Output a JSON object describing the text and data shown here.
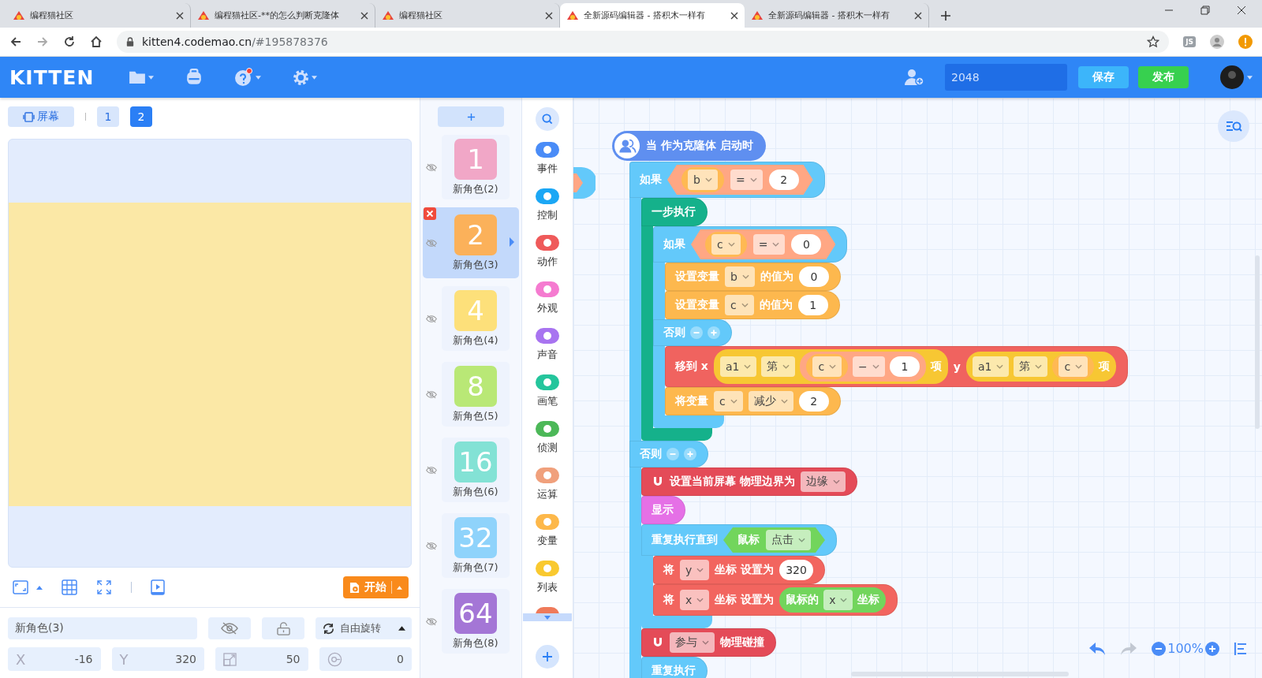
{
  "browser": {
    "tabs": [
      {
        "title": "编程猫社区",
        "selected": false
      },
      {
        "title": "编程猫社区-**的怎么判断克隆体",
        "selected": false
      },
      {
        "title": "编程猫社区",
        "selected": false
      },
      {
        "title": "全新源码编辑器 - 搭积木一样有",
        "selected": true
      },
      {
        "title": "全新源码编辑器 - 搭积木一样有",
        "selected": false
      }
    ],
    "url_host": "kitten4.codemao.cn",
    "url_path": "/#195878376",
    "extension": "JS"
  },
  "app_bar": {
    "logo": "KITTEN",
    "project_name": "2048",
    "save": "保存",
    "publish": "发布"
  },
  "stage_panel": {
    "screen_button": "屏幕",
    "screens": [
      {
        "label": "1",
        "selected": false
      },
      {
        "label": "2",
        "selected": true
      }
    ],
    "start_button": "开始"
  },
  "sprite_props": {
    "name": "新角色(3)",
    "rotation": "自由旋转",
    "fields": [
      {
        "kind": "x",
        "label": "X",
        "value": "-16"
      },
      {
        "kind": "y",
        "label": "Y",
        "value": "320"
      },
      {
        "kind": "size",
        "value": "50"
      },
      {
        "kind": "direction",
        "value": "0"
      }
    ]
  },
  "sprites": [
    {
      "number": "1",
      "name": "新角色(2)",
      "color": "#f1a7c7",
      "selected": false
    },
    {
      "number": "2",
      "name": "新角色(3)",
      "color": "#fbb15a",
      "selected": true
    },
    {
      "number": "4",
      "name": "新角色(4)",
      "color": "#fde07a",
      "selected": false
    },
    {
      "number": "8",
      "name": "新角色(5)",
      "color": "#b9e876",
      "selected": false
    },
    {
      "number": "16",
      "name": "新角色(6)",
      "color": "#83e2d5",
      "selected": false
    },
    {
      "number": "32",
      "name": "新角色(7)",
      "color": "#8fd3fb",
      "selected": false
    },
    {
      "number": "64",
      "name": "新角色(8)",
      "color": "#a476d6",
      "selected": false
    }
  ],
  "categories": [
    {
      "label": "事件",
      "color": "#4a8cf7"
    },
    {
      "label": "控制",
      "color": "#1ba7f5"
    },
    {
      "label": "动作",
      "color": "#ef5a5a"
    },
    {
      "label": "外观",
      "color": "#f57bd0"
    },
    {
      "label": "声音",
      "color": "#a874f0"
    },
    {
      "label": "画笔",
      "color": "#24c59c"
    },
    {
      "label": "侦测",
      "color": "#4cb858"
    },
    {
      "label": "运算",
      "color": "#f0a07c"
    },
    {
      "label": "变量",
      "color": "#fdb84a"
    },
    {
      "label": "列表",
      "color": "#f9c92f"
    }
  ],
  "script": {
    "hat": {
      "label": "当 作为克隆体 启动时",
      "color": "#5f8ff0"
    },
    "blocks": [
      {
        "kind": "if_else",
        "color": "#63c9fa",
        "parts": [
          {
            "kind": "text",
            "text": "如果"
          },
          {
            "kind": "bool",
            "color": "#ffa784",
            "parts": [
              {
                "kind": "reporter",
                "color": "#ffb953",
                "parts": [
                  {
                    "kind": "dropdown",
                    "text": "b"
                  }
                ]
              },
              {
                "kind": "dropdown",
                "text": "="
              },
              {
                "kind": "number",
                "text": "2"
              }
            ]
          }
        ],
        "children": [
          {
            "kind": "c",
            "color": "#15b18b",
            "parts": [
              {
                "kind": "text",
                "text": "一步执行"
              }
            ],
            "children": [
              {
                "kind": "if_else",
                "color": "#63c9fa",
                "parts": [
                  {
                    "kind": "text",
                    "text": "如果"
                  },
                  {
                    "kind": "bool",
                    "color": "#ffa784",
                    "parts": [
                      {
                        "kind": "reporter",
                        "color": "#ffb953",
                        "parts": [
                          {
                            "kind": "dropdown",
                            "text": "c"
                          }
                        ]
                      },
                      {
                        "kind": "dropdown",
                        "text": "="
                      },
                      {
                        "kind": "number",
                        "text": "0"
                      }
                    ]
                  }
                ],
                "children": [
                  {
                    "kind": "stmt",
                    "color": "#fdb84e",
                    "parts": [
                      {
                        "kind": "text",
                        "text": "设置变量"
                      },
                      {
                        "kind": "dropdown",
                        "text": "b"
                      },
                      {
                        "kind": "text",
                        "text": "的值为"
                      },
                      {
                        "kind": "number",
                        "text": "0"
                      }
                    ]
                  },
                  {
                    "kind": "stmt",
                    "color": "#fdb84e",
                    "parts": [
                      {
                        "kind": "text",
                        "text": "设置变量"
                      },
                      {
                        "kind": "dropdown",
                        "text": "c"
                      },
                      {
                        "kind": "text",
                        "text": "的值为"
                      },
                      {
                        "kind": "number",
                        "text": "1"
                      }
                    ]
                  }
                ],
                "else_label": "否则",
                "else_children": [
                  {
                    "kind": "stmt",
                    "color": "#f0635f",
                    "parts": [
                      {
                        "kind": "text",
                        "text": "移到 x"
                      },
                      {
                        "kind": "reporter",
                        "color": "#f7c733",
                        "parts": [
                          {
                            "kind": "dropdown",
                            "text": "a1"
                          },
                          {
                            "kind": "dropdown",
                            "text": "第"
                          },
                          {
                            "kind": "reporter",
                            "color": "#ffa784",
                            "parts": [
                              {
                                "kind": "reporter",
                                "color": "#ffb953",
                                "parts": [
                                  {
                                    "kind": "dropdown",
                                    "text": "c"
                                  }
                                ]
                              },
                              {
                                "kind": "dropdown",
                                "text": "−"
                              },
                              {
                                "kind": "number",
                                "text": "1"
                              }
                            ]
                          },
                          {
                            "kind": "text",
                            "text": "项"
                          }
                        ]
                      },
                      {
                        "kind": "text",
                        "text": "y"
                      },
                      {
                        "kind": "reporter",
                        "color": "#f7c733",
                        "parts": [
                          {
                            "kind": "dropdown",
                            "text": "a1"
                          },
                          {
                            "kind": "dropdown",
                            "text": "第"
                          },
                          {
                            "kind": "reporter",
                            "color": "#ffb953",
                            "parts": [
                              {
                                "kind": "dropdown",
                                "text": "c"
                              }
                            ]
                          },
                          {
                            "kind": "text",
                            "text": "项"
                          }
                        ]
                      }
                    ]
                  },
                  {
                    "kind": "stmt",
                    "color": "#fdb84e",
                    "parts": [
                      {
                        "kind": "text",
                        "text": "将变量"
                      },
                      {
                        "kind": "dropdown",
                        "text": "c"
                      },
                      {
                        "kind": "dropdown",
                        "text": "减少"
                      },
                      {
                        "kind": "number",
                        "text": "2"
                      }
                    ]
                  }
                ]
              }
            ]
          }
        ],
        "else_label": "否则",
        "else_children": [
          {
            "kind": "stmt",
            "color": "#e44b58",
            "parts": [
              {
                "kind": "magnet"
              },
              {
                "kind": "text",
                "text": "设置当前屏幕 物理边界为"
              },
              {
                "kind": "dropdown",
                "text": "边缘"
              }
            ]
          },
          {
            "kind": "stmt",
            "color": "#e570e6",
            "parts": [
              {
                "kind": "text",
                "text": "显示"
              }
            ]
          },
          {
            "kind": "c",
            "color": "#63c9fa",
            "parts": [
              {
                "kind": "text",
                "text": "重复执行直到"
              },
              {
                "kind": "bool",
                "color": "#72d55c",
                "parts": [
                  {
                    "kind": "text",
                    "text": "鼠标"
                  },
                  {
                    "kind": "dropdown",
                    "text": "点击"
                  }
                ]
              }
            ],
            "children": [
              {
                "kind": "stmt",
                "color": "#f2655f",
                "parts": [
                  {
                    "kind": "text",
                    "text": "将"
                  },
                  {
                    "kind": "dropdown",
                    "text": "y"
                  },
                  {
                    "kind": "text",
                    "text": "坐标 设置为"
                  },
                  {
                    "kind": "number",
                    "text": "320"
                  }
                ]
              },
              {
                "kind": "stmt",
                "color": "#f2655f",
                "parts": [
                  {
                    "kind": "text",
                    "text": "将"
                  },
                  {
                    "kind": "dropdown",
                    "text": "x"
                  },
                  {
                    "kind": "text",
                    "text": "坐标 设置为"
                  },
                  {
                    "kind": "reporter",
                    "color": "#72d55c",
                    "parts": [
                      {
                        "kind": "text",
                        "text": "鼠标的"
                      },
                      {
                        "kind": "dropdown",
                        "text": "x"
                      },
                      {
                        "kind": "text",
                        "text": "坐标"
                      }
                    ]
                  }
                ]
              }
            ]
          },
          {
            "kind": "stmt",
            "color": "#e44b58",
            "parts": [
              {
                "kind": "magnet"
              },
              {
                "kind": "dropdown",
                "text": "参与"
              },
              {
                "kind": "text",
                "text": "物理碰撞"
              }
            ]
          },
          {
            "kind": "c",
            "color": "#63c9fa",
            "parts": [
              {
                "kind": "text",
                "text": "重复执行"
              }
            ]
          }
        ]
      }
    ]
  },
  "canvas": {
    "zoom": "100%"
  }
}
